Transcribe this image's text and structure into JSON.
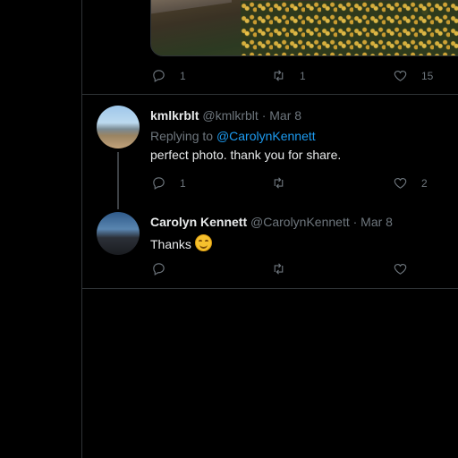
{
  "tweet_top": {
    "actions": {
      "reply_count": "1",
      "retweet_count": "1",
      "like_count": "15"
    }
  },
  "reply1": {
    "display_name": "kmlkrblt",
    "handle": "@kmlkrblt",
    "date": "· Mar 8",
    "replying_prefix": "Replying to",
    "replying_to": "@CarolynKennett",
    "text": "perfect photo. thank you for share.",
    "actions": {
      "reply_count": "1",
      "retweet_count": "",
      "like_count": "2"
    }
  },
  "reply2": {
    "display_name": "Carolyn Kennett",
    "handle": "@CarolynKennett",
    "date": "· Mar 8",
    "text": "Thanks",
    "emoji": "smiling-face-emoji",
    "actions": {
      "reply_count": "",
      "retweet_count": "",
      "like_count": ""
    }
  },
  "colors": {
    "background": "#000000",
    "mention": "#1d9bf0",
    "muted": "#6e767d",
    "text": "#e7e9ea",
    "border": "#2f3336"
  }
}
